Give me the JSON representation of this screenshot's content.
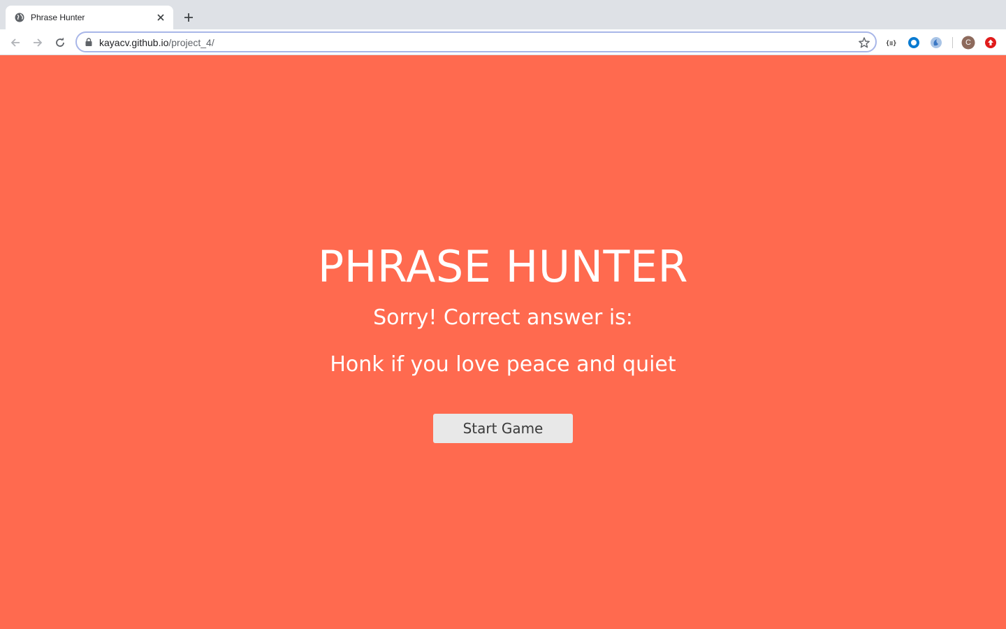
{
  "browser": {
    "tab": {
      "title": "Phrase Hunter",
      "favicon": "globe-icon"
    },
    "address_bar": {
      "host": "kayacv.github.io",
      "path": "/project_4/"
    },
    "profile_initial": "C",
    "extensions": [
      "json-viewer-icon",
      "circle-extension-icon",
      "blue-swirl-extension-icon",
      "red-upload-extension-icon"
    ]
  },
  "game": {
    "title": "PHRASE HUNTER",
    "message": "Sorry! Correct answer is:",
    "phrase": "Honk if you love peace and quiet",
    "start_button": "Start Game"
  },
  "colors": {
    "overlay_background": "#ff6a4f",
    "button_background": "#e8e8e8",
    "text": "#ffffff"
  }
}
